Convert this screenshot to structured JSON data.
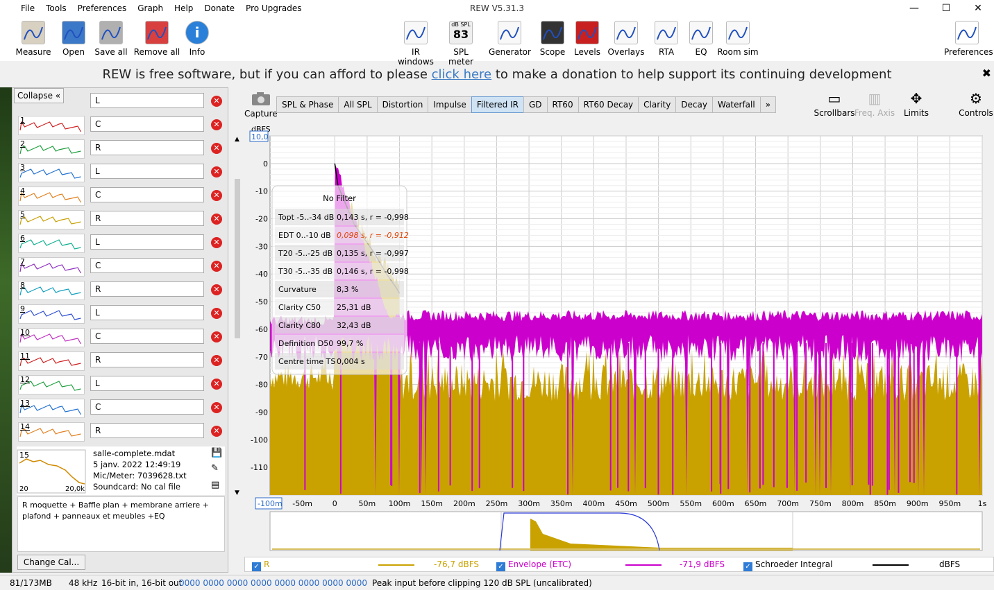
{
  "window": {
    "title": "REW V5.31.3",
    "min": "—",
    "max": "☐",
    "close": "✕"
  },
  "menu": [
    "File",
    "Tools",
    "Preferences",
    "Graph",
    "Help",
    "Donate",
    "Pro Upgrades"
  ],
  "toolbar_left": [
    {
      "label": "Measure",
      "icon": "measure-icon"
    },
    {
      "label": "Open",
      "icon": "folder-icon"
    },
    {
      "label": "Save all",
      "icon": "save-icon"
    },
    {
      "label": "Remove all",
      "icon": "remove-icon"
    },
    {
      "label": "Info",
      "icon": "info-icon"
    }
  ],
  "toolbar_center": [
    {
      "label": "IR windows",
      "icon": "ir-windows-icon"
    },
    {
      "label": "SPL meter",
      "icon": "spl-meter-icon",
      "top": "dB SPL",
      "value": "83"
    },
    {
      "label": "Generator",
      "icon": "generator-icon"
    },
    {
      "label": "Scope",
      "icon": "scope-icon"
    },
    {
      "label": "Levels",
      "icon": "levels-icon"
    },
    {
      "label": "Overlays",
      "icon": "overlays-icon"
    },
    {
      "label": "RTA",
      "icon": "rta-icon"
    },
    {
      "label": "EQ",
      "icon": "eq-icon"
    },
    {
      "label": "Room sim",
      "icon": "room-sim-icon"
    }
  ],
  "toolbar_right": {
    "label": "Preferences",
    "icon": "preferences-icon"
  },
  "donate": {
    "pre": "REW is free software, but if you can afford to please ",
    "link": "click here",
    "post": " to make a donation to help support its continuing development",
    "close": "✖"
  },
  "left": {
    "collapse": "Collapse  «",
    "first": "L",
    "measurements": [
      {
        "num": "1",
        "name": "C",
        "color": "#d02020"
      },
      {
        "num": "2",
        "name": "R",
        "color": "#20a040"
      },
      {
        "num": "3",
        "name": "L",
        "color": "#2070d0"
      },
      {
        "num": "4",
        "name": "C",
        "color": "#e08020"
      },
      {
        "num": "5",
        "name": "R",
        "color": "#c8a000"
      },
      {
        "num": "6",
        "name": "L",
        "color": "#10b090"
      },
      {
        "num": "7",
        "name": "C",
        "color": "#9030c0"
      },
      {
        "num": "8",
        "name": "R",
        "color": "#10a0c0"
      },
      {
        "num": "9",
        "name": "L",
        "color": "#3050d0"
      },
      {
        "num": "10",
        "name": "C",
        "color": "#c030c0"
      },
      {
        "num": "11",
        "name": "R",
        "color": "#d02020"
      },
      {
        "num": "12",
        "name": "L",
        "color": "#20a040"
      },
      {
        "num": "13",
        "name": "C",
        "color": "#2070d0"
      },
      {
        "num": "14",
        "name": "R",
        "color": "#e08020"
      }
    ],
    "selected": {
      "num": "15",
      "file": "salle-complete.mdat",
      "date": "5 janv. 2022 12:49:19",
      "mic": "Mic/Meter: 7039628.txt",
      "soundcard": "Soundcard: No cal file",
      "x_lo": "20",
      "x_hi": "20,0k"
    },
    "notes": "R moquette + Baffle plan + membrane arriere + plafond + panneaux et meubles +EQ",
    "change_cal": "Change Cal..."
  },
  "capture": "Capture",
  "tabs": [
    "SPL & Phase",
    "All SPL",
    "Distortion",
    "Impulse",
    "Filtered IR",
    "GD",
    "RT60",
    "RT60 Decay",
    "Clarity",
    "Decay",
    "Waterfall",
    "»"
  ],
  "selected_tab": "Filtered IR",
  "right_tools": [
    {
      "label": "Scrollbars",
      "icon": "scrollbars-icon"
    },
    {
      "label": "Freq. Axis",
      "icon": "freq-axis-icon"
    },
    {
      "label": "Limits",
      "icon": "limits-icon"
    },
    {
      "label": "Controls",
      "icon": "controls-icon"
    }
  ],
  "chart_data": {
    "type": "area",
    "ylabel": "dBFS",
    "ytop": "10,0",
    "xleft": "-100m",
    "ylim": [
      -120,
      10
    ],
    "xlim": [
      -0.1,
      1.0
    ],
    "yticks": [
      "0",
      "-10",
      "-20",
      "-30",
      "-40",
      "-50",
      "-60",
      "-70",
      "-80",
      "-90",
      "-100",
      "-110"
    ],
    "xticks": [
      "-50m",
      "0",
      "50m",
      "100m",
      "150m",
      "200m",
      "250m",
      "300m",
      "350m",
      "400m",
      "450m",
      "500m",
      "550m",
      "600m",
      "650m",
      "700m",
      "750m",
      "800m",
      "850m",
      "900m",
      "950m",
      "1s"
    ],
    "series": [
      {
        "name": "R",
        "color": "#c9a200",
        "level": "-76,7 dBFS"
      },
      {
        "name": "Envelope (ETC)",
        "color": "#cc00cc",
        "level": "-71,9 dBFS"
      },
      {
        "name": "Schroeder Integral",
        "color": "#000000",
        "level": "dBFS"
      }
    ],
    "noise_floor_etc": -55,
    "noise_floor_ir": -78,
    "schroeder": {
      "x": [
        0,
        0.005,
        0.03,
        0.06,
        0.08,
        0.095,
        0.1
      ],
      "y": [
        0,
        -8,
        -22,
        -32,
        -40,
        -45,
        -47
      ]
    },
    "overlay": {
      "title": "No Filter",
      "rows": [
        {
          "label": "Topt -5..-34 dB",
          "value": "0,143 s,   r = -0,998",
          "highlight": false
        },
        {
          "label": "EDT  0..-10 dB",
          "value": "0,098 s,  r = -0,912",
          "highlight": true
        },
        {
          "label": "T20 -5..-25 dB",
          "value": "0,135 s,   r = -0,997",
          "highlight": false
        },
        {
          "label": "T30 -5..-35 dB",
          "value": "0,146 s,   r = -0,998",
          "highlight": false
        },
        {
          "label": "Curvature",
          "value": "8,3 %",
          "highlight": false
        },
        {
          "label": "Clarity C50",
          "value": "25,31 dB",
          "highlight": false
        },
        {
          "label": "Clarity C80",
          "value": "32,43 dB",
          "highlight": false
        },
        {
          "label": "Definition D50",
          "value": "99,7 %",
          "highlight": false
        },
        {
          "label": "Centre time TS",
          "value": "0,004 s",
          "highlight": false
        }
      ]
    }
  },
  "status": {
    "mem": "81/173MB",
    "rate": "48 kHz",
    "bits": "16-bit in, 16-bit out",
    "hex": "0000 0000  0000 0000  0000 0000  0000 0000",
    "peak": "Peak input before clipping 120 dB SPL (uncalibrated)"
  }
}
